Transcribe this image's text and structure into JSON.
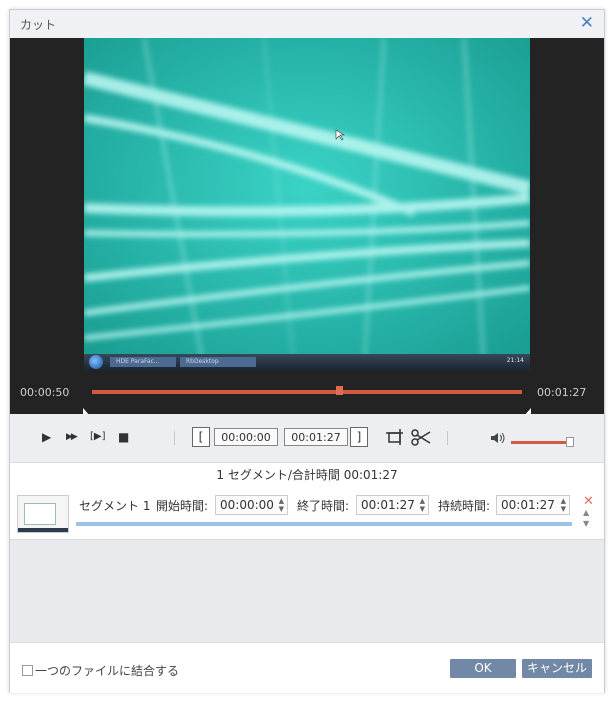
{
  "window": {
    "title": "カット",
    "close_glyph": "✕"
  },
  "player": {
    "current_time": "00:00:50",
    "total_time": "00:01:27",
    "progress": 0.575,
    "taskbar": {
      "item1": "HDE  ParaFac...",
      "item2": "RbDesktop",
      "tray_time": "21:14"
    }
  },
  "controls": {
    "play_glyph": "▶",
    "next_frame_glyph": "▶▶",
    "frame_step_glyph": "[▶]",
    "stop_glyph": "■",
    "start_bracket": "[",
    "start_time": "00:00:00",
    "end_time": "00:01:27",
    "end_bracket": "]",
    "volume_level": 0.95
  },
  "summary": {
    "text": "1 セグメント/合計時間 00:01:27"
  },
  "segment": {
    "name": "セグメント 1",
    "start_label": "開始時間:",
    "start_value": "00:00:00",
    "end_label": "終了時間:",
    "end_value": "00:01:27",
    "duration_label": "持続時間:",
    "duration_value": "00:01:27",
    "delete_glyph": "✕",
    "up_glyph": "▲",
    "down_glyph": "▼"
  },
  "footer": {
    "merge_label": "一つのファイルに結合する",
    "merge_checked": false,
    "ok_label": "OK",
    "cancel_label": "キャンセル"
  },
  "colors": {
    "accent": "#d35a42",
    "button": "#7189a6",
    "segment_bar": "#9dc1ea",
    "video": "#27b8ad"
  }
}
